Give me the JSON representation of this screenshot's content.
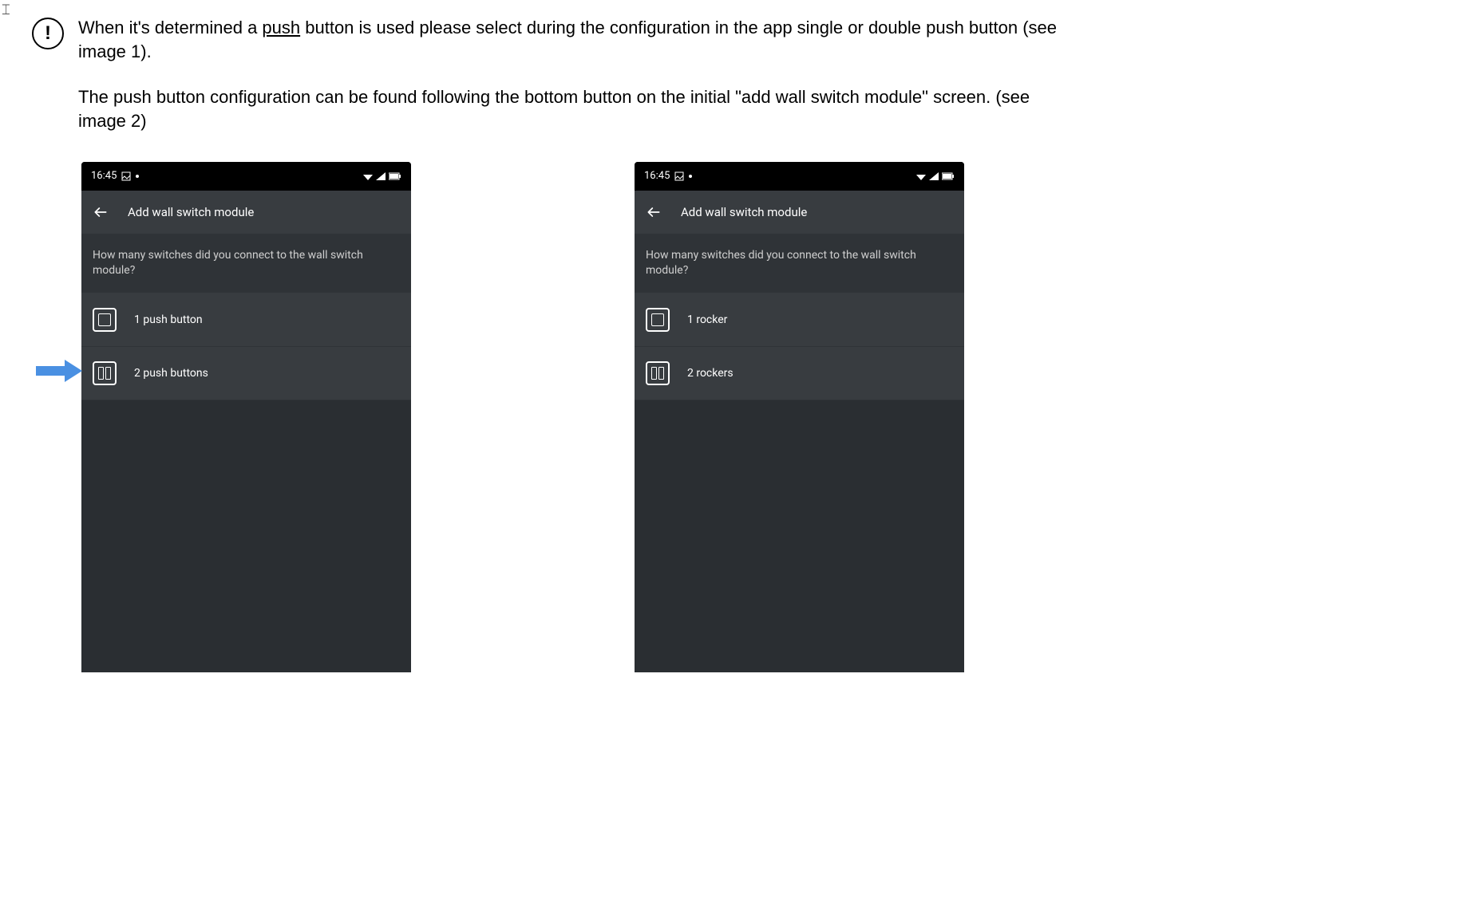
{
  "paragraph1_pre": "When it's determined a ",
  "paragraph1_underlined": "push",
  "paragraph1_post": " button is used please select during the configuration in the app single or double push button (see image 1).",
  "paragraph2": "The push button configuration can be found following the bottom button on the initial \"add wall switch module\" screen. (see image 2)",
  "phone1": {
    "time": "16:45",
    "title": "Add wall switch module",
    "question": "How many switches did you connect to the wall switch module?",
    "option1": "1 push button",
    "option2": "2 push buttons"
  },
  "phone2": {
    "time": "16:45",
    "title": "Add wall switch module",
    "question": "How many switches did you connect to the wall switch module?",
    "option1": "1 rocker",
    "option2": "2 rockers"
  }
}
